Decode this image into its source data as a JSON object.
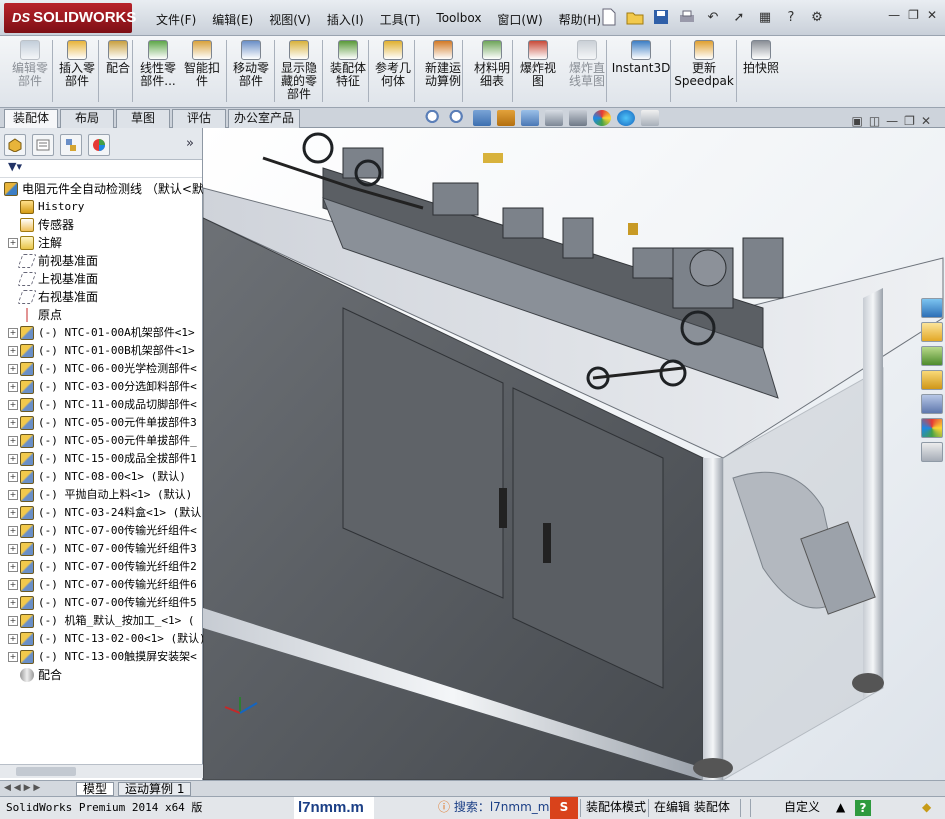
{
  "app": {
    "logo_brand": "SOLIDWORKS",
    "logo_prefix": "DS"
  },
  "menu": [
    "文件(F)",
    "编辑(E)",
    "视图(V)",
    "插入(I)",
    "工具(T)",
    "Toolbox",
    "窗口(W)",
    "帮助(H)"
  ],
  "ribbon": [
    {
      "label": "编辑零部件",
      "disabled": true
    },
    {
      "label": "插入零部件",
      "disabled": false
    },
    {
      "label": "配合",
      "disabled": false
    },
    {
      "label": "线性零部件...",
      "disabled": false
    },
    {
      "label": "智能扣件",
      "disabled": false
    },
    {
      "label": "移动零部件",
      "disabled": false
    },
    {
      "label": "显示隐藏的零部件",
      "disabled": false
    },
    {
      "label": "装配体特征",
      "disabled": false
    },
    {
      "label": "参考几何体",
      "disabled": false
    },
    {
      "label": "新建运动算例",
      "disabled": false
    },
    {
      "label": "材料明细表",
      "disabled": false
    },
    {
      "label": "爆炸视图",
      "disabled": false
    },
    {
      "label": "爆炸直线草图",
      "disabled": true
    },
    {
      "label": "Instant3D",
      "disabled": false
    },
    {
      "label": "更新Speedpak",
      "disabled": false
    },
    {
      "label": "拍快照",
      "disabled": false
    }
  ],
  "tabs": [
    "装配体",
    "布局",
    "草图",
    "评估",
    "办公室产品"
  ],
  "active_tab": "装配体",
  "tree": {
    "root": "电阻元件全自动检测线 （默认<默",
    "items": [
      {
        "label": "History",
        "type": "history"
      },
      {
        "label": "传感器",
        "type": "sensor"
      },
      {
        "label": "注解",
        "type": "annotation"
      },
      {
        "label": "前视基准面",
        "type": "plane"
      },
      {
        "label": "上视基准面",
        "type": "plane"
      },
      {
        "label": "右视基准面",
        "type": "plane"
      },
      {
        "label": "原点",
        "type": "origin"
      },
      {
        "label": "(-) NTC-01-00A机架部件<1>",
        "type": "part"
      },
      {
        "label": "(-) NTC-01-00B机架部件<1>",
        "type": "part"
      },
      {
        "label": "(-) NTC-06-00光学检测部件<",
        "type": "part"
      },
      {
        "label": "(-) NTC-03-00分选卸料部件<",
        "type": "part"
      },
      {
        "label": "(-) NTC-11-00成品切脚部件<",
        "type": "part"
      },
      {
        "label": "(-) NTC-05-00元件单拔部件3",
        "type": "part"
      },
      {
        "label": "(-) NTC-05-00元件单拔部件_",
        "type": "part"
      },
      {
        "label": "(-) NTC-15-00成品全拔部件1",
        "type": "part"
      },
      {
        "label": "(-) NTC-08-00<1> (默认)",
        "type": "part"
      },
      {
        "label": "(-) 平抛自动上料<1> (默认)",
        "type": "part"
      },
      {
        "label": "(-) NTC-03-24料盒<1> (默认",
        "type": "part"
      },
      {
        "label": "(-) NTC-07-00传输光纤组件<",
        "type": "part"
      },
      {
        "label": "(-) NTC-07-00传输光纤组件3",
        "type": "part"
      },
      {
        "label": "(-) NTC-07-00传输光纤组件2",
        "type": "part"
      },
      {
        "label": "(-) NTC-07-00传输光纤组件6",
        "type": "part"
      },
      {
        "label": "(-) NTC-07-00传输光纤组件5",
        "type": "part"
      },
      {
        "label": "(-) 机箱_默认_按加工_<1> (",
        "type": "part"
      },
      {
        "label": "(-) NTC-13-02-00<1> (默认)",
        "type": "part"
      },
      {
        "label": "(-) NTC-13-00触摸屏安装架<",
        "type": "part"
      },
      {
        "label": "配合",
        "type": "mates"
      }
    ]
  },
  "bottom_tabs": [
    "模型",
    "运动算例 1"
  ],
  "status": {
    "product": "SolidWorks Premium 2014 x64 版",
    "input": "l7nmm.m",
    "search_label": "搜索：l7nmm_m",
    "mode": "装配体模式",
    "editing": "在编辑 装配体",
    "units": "自定义"
  },
  "colors": {
    "accent_red": "#b8232b",
    "frame": "#cdd3db",
    "viewport_bg": "#ffffff"
  }
}
